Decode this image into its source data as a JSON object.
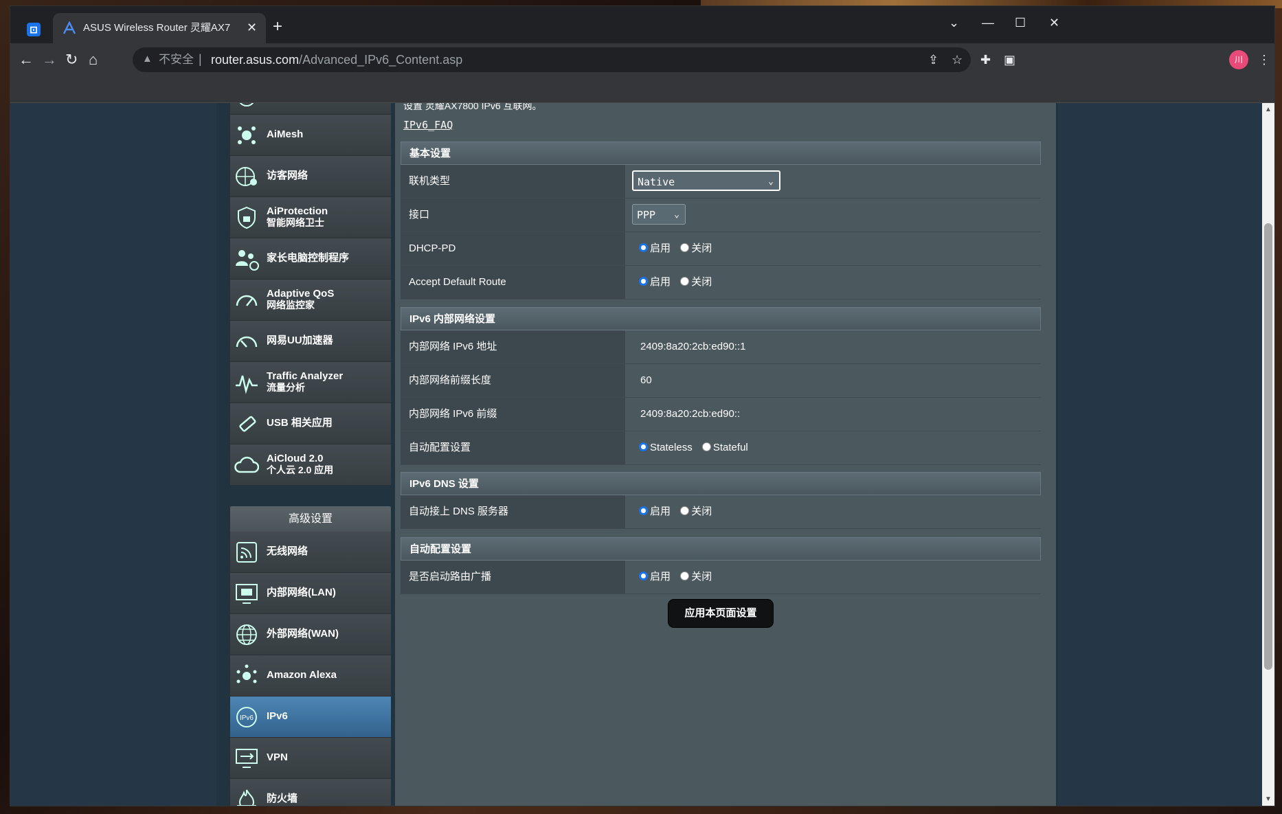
{
  "browser": {
    "tab_title": "ASUS Wireless Router 灵耀AX7",
    "close_glyph": "✕",
    "new_tab_glyph": "+",
    "insecure_label": "不安全",
    "url_host": "router.asus.com",
    "url_path": "/Advanced_IPv6_Content.asp",
    "avatar_initials": "川"
  },
  "sidebar": {
    "general_items": [
      {
        "label": "AiMesh",
        "sub": ""
      },
      {
        "label": "访客网络",
        "sub": ""
      },
      {
        "label": "AiProtection",
        "sub": "智能网络卫士"
      },
      {
        "label": "家长电脑控制程序",
        "sub": ""
      },
      {
        "label": "Adaptive QoS",
        "sub": "网络监控家"
      },
      {
        "label": "网易UU加速器",
        "sub": ""
      },
      {
        "label": "Traffic Analyzer",
        "sub": "流量分析"
      },
      {
        "label": "USB 相关应用",
        "sub": ""
      },
      {
        "label": "AiCloud 2.0",
        "sub": "个人云 2.0 应用"
      }
    ],
    "advanced_header": "高级设置",
    "advanced_items": [
      {
        "label": "无线网络"
      },
      {
        "label": "内部网络(LAN)"
      },
      {
        "label": "外部网络(WAN)"
      },
      {
        "label": "Amazon Alexa"
      },
      {
        "label": "IPv6"
      },
      {
        "label": "VPN"
      },
      {
        "label": "防火墙"
      }
    ]
  },
  "content": {
    "intro_text": "设置 灵耀AX7800 IPv6 互联网。",
    "faq_link": "IPv6_FAQ",
    "basic": {
      "header": "基本设置",
      "conn_type_label": "联机类型",
      "conn_type_value": "Native",
      "interface_label": "接口",
      "interface_value": "PPP",
      "dhcp_pd_label": "DHCP-PD",
      "accept_route_label": "Accept Default Route",
      "enable": "启用",
      "disable": "关闭"
    },
    "lan": {
      "header": "IPv6 内部网络设置",
      "addr_label": "内部网络 IPv6 地址",
      "addr_value": "2409:8a20:2cb:ed90::1",
      "prefix_len_label": "内部网络前缀长度",
      "prefix_len_value": "60",
      "prefix_label": "内部网络 IPv6 前缀",
      "prefix_value": "2409:8a20:2cb:ed90::",
      "autoconf_label": "自动配置设置",
      "stateless": "Stateless",
      "stateful": "Stateful"
    },
    "dns": {
      "header": "IPv6 DNS 设置",
      "auto_dns_label": "自动接上 DNS 服务器"
    },
    "autoconf": {
      "header": "自动配置设置",
      "router_adv_label": "是否启动路由广播"
    },
    "apply_button": "应用本页面设置"
  },
  "colors": {
    "active_item": "#4d86b5",
    "radio_selected": "#1a73e8",
    "content_bg": "#4b585e",
    "label_bg": "#3d484e"
  }
}
